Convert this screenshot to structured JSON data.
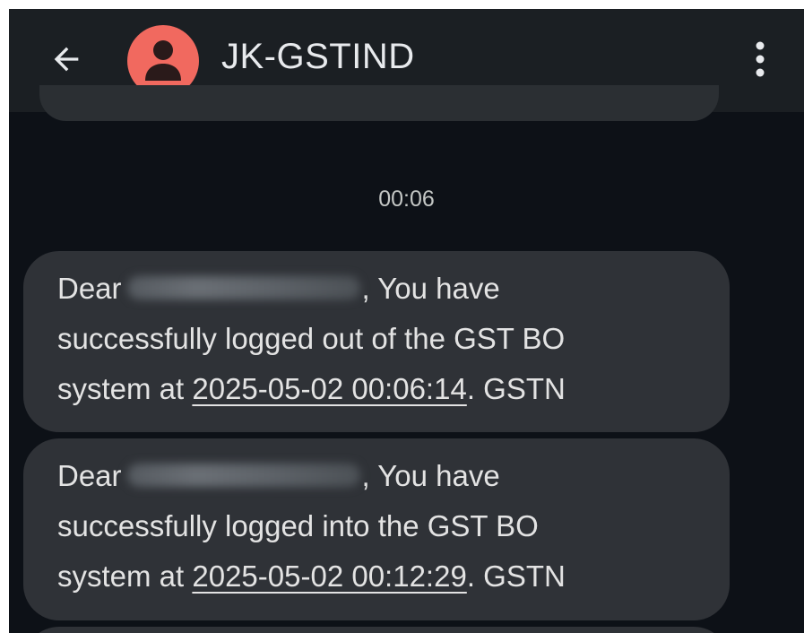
{
  "header": {
    "title": "JK-GSTIND",
    "back_icon": "arrow-left-icon",
    "avatar_icon": "person-icon",
    "avatar_color": "#f1695f",
    "menu_icon": "more-vertical-icon"
  },
  "conversation": {
    "timestamp": "00:06",
    "messages": [
      {
        "greeting": "Dear",
        "after_name": ", You have",
        "line2": "successfully logged out of the GST BO",
        "line3_prefix": "system at ",
        "datetime": "2025-05-02 00:06:14",
        "line3_suffix": ". GSTN"
      },
      {
        "greeting": "Dear",
        "after_name": ", You have",
        "line2": "successfully logged into the GST BO",
        "line3_prefix": "system at ",
        "datetime": "2025-05-02 00:12:29",
        "line3_suffix": ". GSTN"
      }
    ]
  },
  "colors": {
    "background": "#0d1117",
    "appbar": "#1b1f23",
    "bubble": "#2f3237",
    "text": "#e3e3e3"
  }
}
